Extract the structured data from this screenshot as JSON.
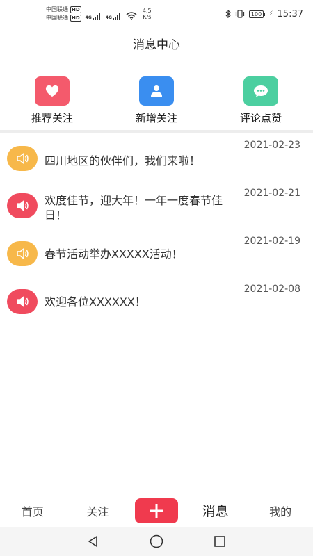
{
  "status_bar": {
    "carrier1": "中国联通",
    "carrier2": "中国联通",
    "hd": "HD",
    "net_type": "4G",
    "net_speed_value": "4.5",
    "net_speed_unit": "K/s",
    "battery": "100",
    "time": "15:37"
  },
  "header": {
    "title": "消息中心"
  },
  "categories": [
    {
      "label": "推荐关注",
      "icon": "heart-icon",
      "color": "#f45a6c"
    },
    {
      "label": "新增关注",
      "icon": "user-icon",
      "color": "#3a8ef0"
    },
    {
      "label": "评论点赞",
      "icon": "chat-icon",
      "color": "#4ccfa0"
    }
  ],
  "messages": [
    {
      "date": "2021-02-23",
      "text": "四川地区的伙伴们，我们来啦！",
      "icon": "speaker-icon",
      "color": "#f7b84a"
    },
    {
      "date": "2021-02-21",
      "text": "欢度佳节，迎大年！一年一度春节佳日！",
      "icon": "speaker-icon",
      "color": "#f04b5e"
    },
    {
      "date": "2021-02-19",
      "text": "春节活动举办XXXXX活动！",
      "icon": "speaker-icon",
      "color": "#f7b84a"
    },
    {
      "date": "2021-02-08",
      "text": "欢迎各位XXXXXX！",
      "icon": "speaker-icon",
      "color": "#f04b5e"
    }
  ],
  "bottom_nav": {
    "home": "首页",
    "follow": "关注",
    "messages": "消息",
    "mine": "我的",
    "add_color": "#f03a4e"
  }
}
